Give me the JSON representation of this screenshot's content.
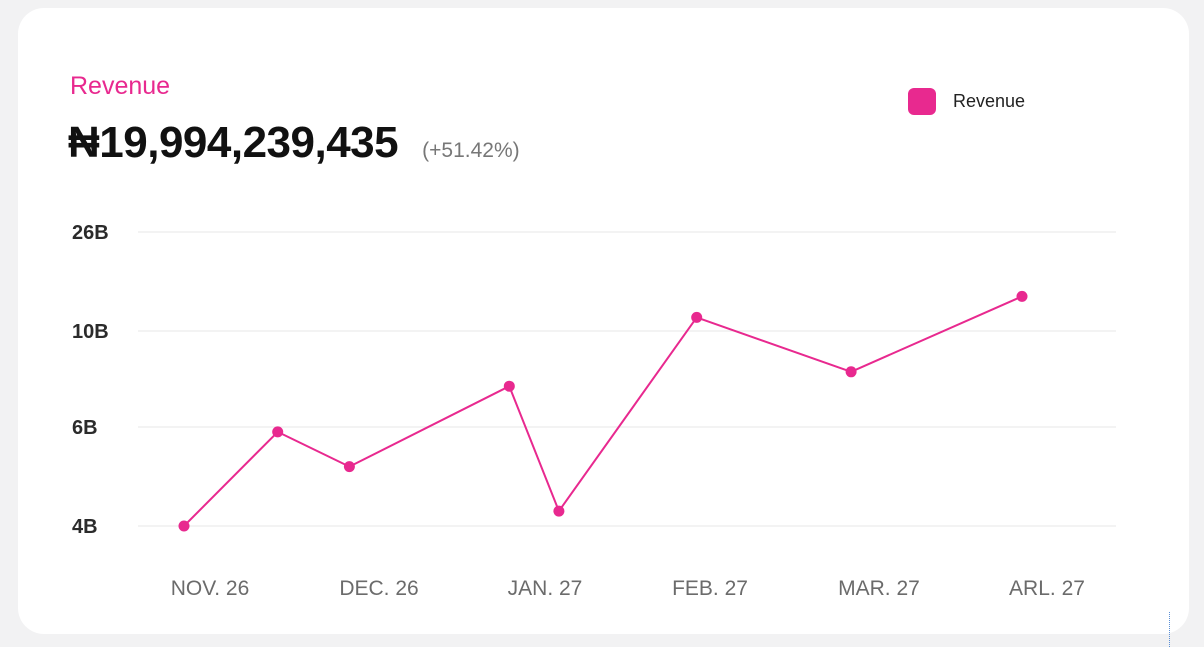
{
  "card": {
    "title": "Revenue",
    "total": "₦19,994,239,435",
    "change": "(+51.42%)"
  },
  "colors": {
    "accent": "#e8298f",
    "grid": "#ececec",
    "background": "#f2f2f3",
    "card": "#ffffff"
  },
  "chart_data": {
    "type": "line",
    "title": "",
    "xlabel": "",
    "ylabel": "",
    "y_scale": "categorical-steps",
    "y_ticks": [
      {
        "label": "4B",
        "value": 4000000000
      },
      {
        "label": "6B",
        "value": 6000000000
      },
      {
        "label": "10B",
        "value": 10000000000
      },
      {
        "label": "26B",
        "value": 26000000000
      }
    ],
    "x_ticks": [
      "NOV. 26",
      "DEC. 26",
      "JAN. 27",
      "FEB. 27",
      "MAR. 27",
      "ARL. 27"
    ],
    "x_range": [
      "2025-11-26",
      "2026-04-27"
    ],
    "series": [
      {
        "name": "Revenue",
        "color": "#e8298f",
        "points": [
          {
            "x": "2025-11-26",
            "y": 4000000000
          },
          {
            "x": "2025-12-13",
            "y": 5900000000
          },
          {
            "x": "2025-12-26",
            "y": 5200000000
          },
          {
            "x": "2026-01-24",
            "y": 7700000000
          },
          {
            "x": "2026-02-02",
            "y": 4300000000
          },
          {
            "x": "2026-02-27",
            "y": 12200000000
          },
          {
            "x": "2026-03-27",
            "y": 8300000000
          },
          {
            "x": "2026-04-27",
            "y": 15600000000
          }
        ]
      }
    ],
    "legend": {
      "position": "top-right",
      "entries": [
        "Revenue"
      ]
    },
    "grid": true
  }
}
